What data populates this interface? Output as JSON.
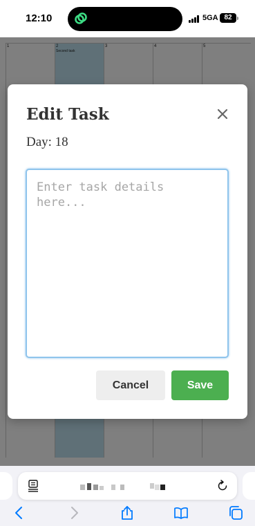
{
  "status_bar": {
    "time": "12:10",
    "network": "5GA",
    "battery": "82"
  },
  "calendar": {
    "days": [
      {
        "label": "1",
        "task": ""
      },
      {
        "label": "2",
        "task": "Second task"
      },
      {
        "label": "3",
        "task": ""
      },
      {
        "label": "4",
        "task": ""
      },
      {
        "label": "5",
        "task": ""
      }
    ]
  },
  "modal": {
    "title": "Edit Task",
    "day_label": "Day: 18",
    "task_value": "",
    "task_placeholder": "Enter task details here...",
    "cancel_label": "Cancel",
    "save_label": "Save"
  },
  "colors": {
    "save": "#4caf50",
    "cancel": "#eeeeee",
    "input_focus": "#8fc4ec",
    "highlight_cell": "#bfe1ee",
    "safari_icons": "#007aff"
  },
  "icons": {
    "close": "close-icon",
    "reader": "reader-mode-icon",
    "reload": "reload-icon",
    "back": "chevron-left-icon",
    "forward": "chevron-right-icon",
    "share": "share-icon",
    "bookmarks": "book-icon",
    "tabs": "tabs-icon"
  }
}
